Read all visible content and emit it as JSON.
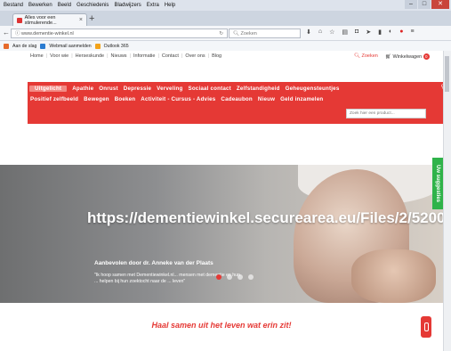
{
  "browser": {
    "menu": [
      "Bestand",
      "Bewerken",
      "Beeld",
      "Geschiedenis",
      "Bladwijzers",
      "Extra",
      "Help"
    ],
    "tab_title": "Alles voor een stimulerende...",
    "url": "www.dementie-winkel.nl",
    "search_placeholder": "Zoeken",
    "bookmarks": [
      {
        "label": "Aan de slag",
        "color": "#e66a2c"
      },
      {
        "label": "Webmail aanmelden",
        "color": "#2a7bd1"
      },
      {
        "label": "Outlook 365",
        "color": "#f3a31b"
      }
    ]
  },
  "site": {
    "accent_color": "#e53935",
    "topnav": [
      "Home",
      "Voor wie",
      "Herseskunde",
      "Nieuws",
      "Informatie",
      "Contact",
      "Over ons",
      "Blog"
    ],
    "zoeken": "Zoeken",
    "cart_label": "Winkelwagen",
    "cart_count": "0",
    "categories_row1": [
      "Uitgelicht",
      "Apathie",
      "Onrust",
      "Depressie",
      "Verveling",
      "Sociaal contact",
      "Zelfstandigheid",
      "Geheugensteuntjes"
    ],
    "categories_row2": [
      "Positief zelfbeeld",
      "Bewegen",
      "Boeken",
      "Activiteit - Cursus - Advies",
      "Cadeaubon",
      "Nieuw",
      "Geld inzamelen"
    ],
    "product_search_placeholder": "Zoek hier een product...",
    "hero": {
      "image_alt": "https://dementiewinkel.securearea.eu/Files/2/52000/52599/PageHomePhotos/1313261_nl.jpg",
      "subtitle": "Aanbevolen door dr. Anneke van der Plaats",
      "quote": "\"Ik hoop samen met Dementiewinkel.nl... mensen met dementie en hun ... helpen bij hun zoektocht naar de ... leven\""
    },
    "suggest_tab": "Uw suggesties",
    "slogan": "Haal samen uit het leven wat erin zit!"
  }
}
